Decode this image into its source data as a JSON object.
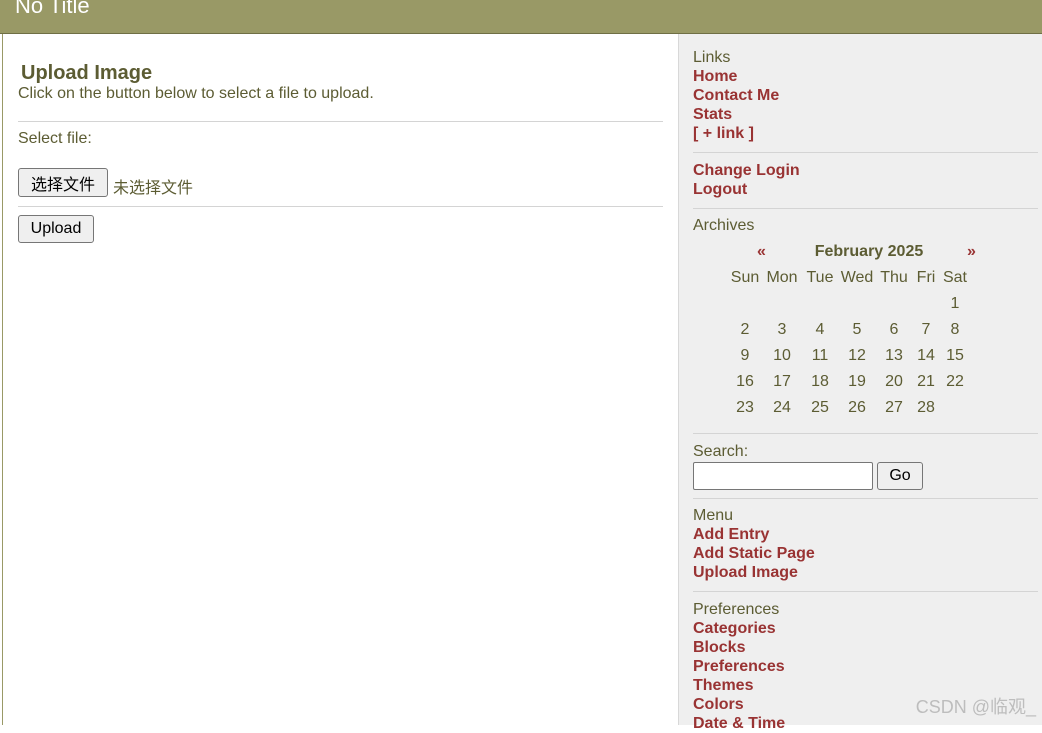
{
  "header": {
    "title": "No Title"
  },
  "upload": {
    "title": "Upload Image",
    "description": "Click on the button below to select a file to upload.",
    "select_label": "Select file:",
    "file_button": "选择文件",
    "file_status": "未选择文件",
    "upload_button": "Upload"
  },
  "sidebar": {
    "links_heading": "Links",
    "links": [
      "Home",
      "Contact Me",
      "Stats",
      "[ + link ]"
    ],
    "account_links": [
      "Change Login",
      "Logout"
    ],
    "archives_heading": "Archives",
    "calendar": {
      "prev": "«",
      "month": "February 2025",
      "next": "»",
      "weekdays": [
        "Sun",
        "Mon",
        "Tue",
        "Wed",
        "Thu",
        "Fri",
        "Sat"
      ],
      "weeks": [
        [
          "",
          "",
          "",
          "",
          "",
          "",
          "1"
        ],
        [
          "2",
          "3",
          "4",
          "5",
          "6",
          "7",
          "8"
        ],
        [
          "9",
          "10",
          "11",
          "12",
          "13",
          "14",
          "15"
        ],
        [
          "16",
          "17",
          "18",
          "19",
          "20",
          "21",
          "22"
        ],
        [
          "23",
          "24",
          "25",
          "26",
          "27",
          "28",
          ""
        ]
      ]
    },
    "search_heading": "Search:",
    "search_value": "",
    "go_button": "Go",
    "menu_heading": "Menu",
    "menu_links": [
      "Add Entry",
      "Add Static Page",
      "Upload Image"
    ],
    "preferences_heading": "Preferences",
    "preferences_links": [
      "Categories",
      "Blocks",
      "Preferences",
      "Themes",
      "Colors",
      "Date & Time"
    ]
  },
  "watermark": "CSDN @临观_"
}
